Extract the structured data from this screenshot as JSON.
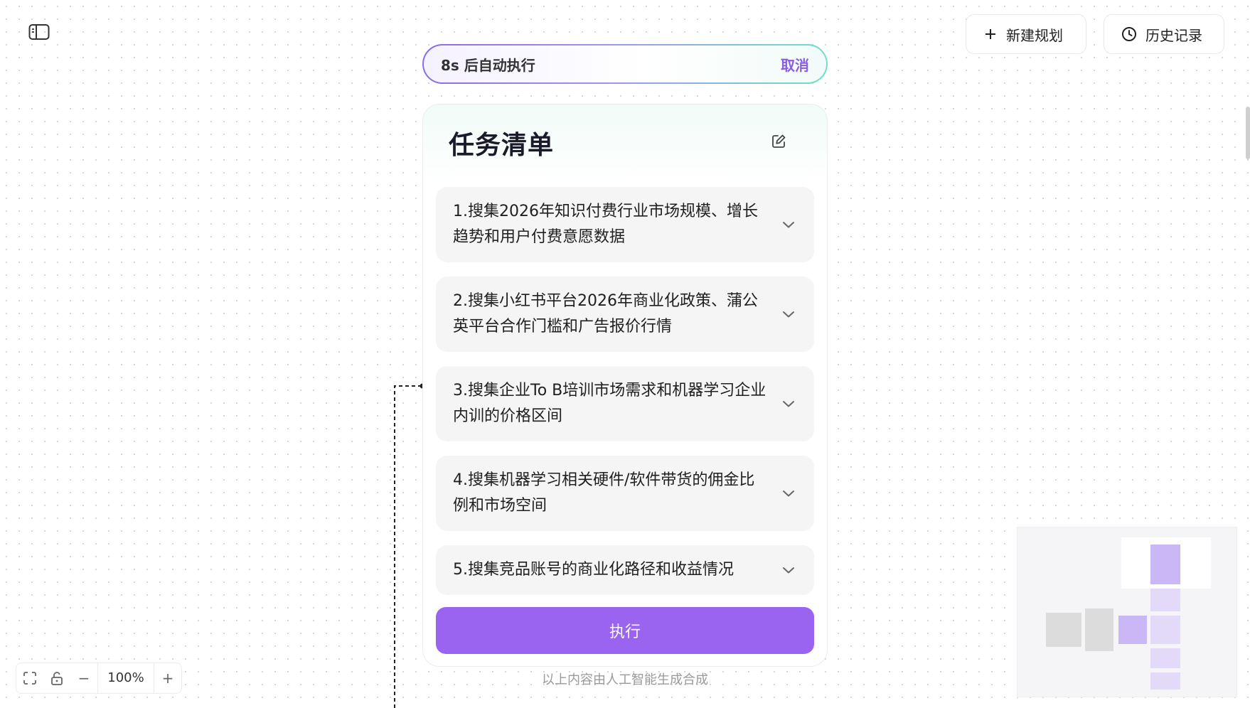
{
  "header": {
    "new_plan_label": "新建规划",
    "history_label": "历史记录"
  },
  "banner": {
    "auto_text": "8s 后自动执行",
    "cancel_label": "取消"
  },
  "card": {
    "title": "任务清单",
    "tasks": [
      {
        "label": "1.搜集2026年知识付费行业市场规模、增长趋势和用户付费意愿数据"
      },
      {
        "label": "2.搜集小红书平台2026年商业化政策、蒲公英平台合作门槛和广告报价行情"
      },
      {
        "label": "3.搜集企业To B培训市场需求和机器学习企业内训的价格区间"
      },
      {
        "label": "4.搜集机器学习相关硬件/软件带货的佣金比例和市场空间"
      },
      {
        "label": "5.搜集竞品账号的商业化路径和收益情况"
      }
    ],
    "execute_label": "执行",
    "ai_note": "以上内容由人工智能生成合成"
  },
  "zoom": {
    "level": "100%",
    "minus": "−",
    "plus": "+"
  },
  "colors": {
    "accent": "#9a63f0",
    "cancel": "#8a5ce6",
    "minimap_node": "#c9b8f5"
  }
}
